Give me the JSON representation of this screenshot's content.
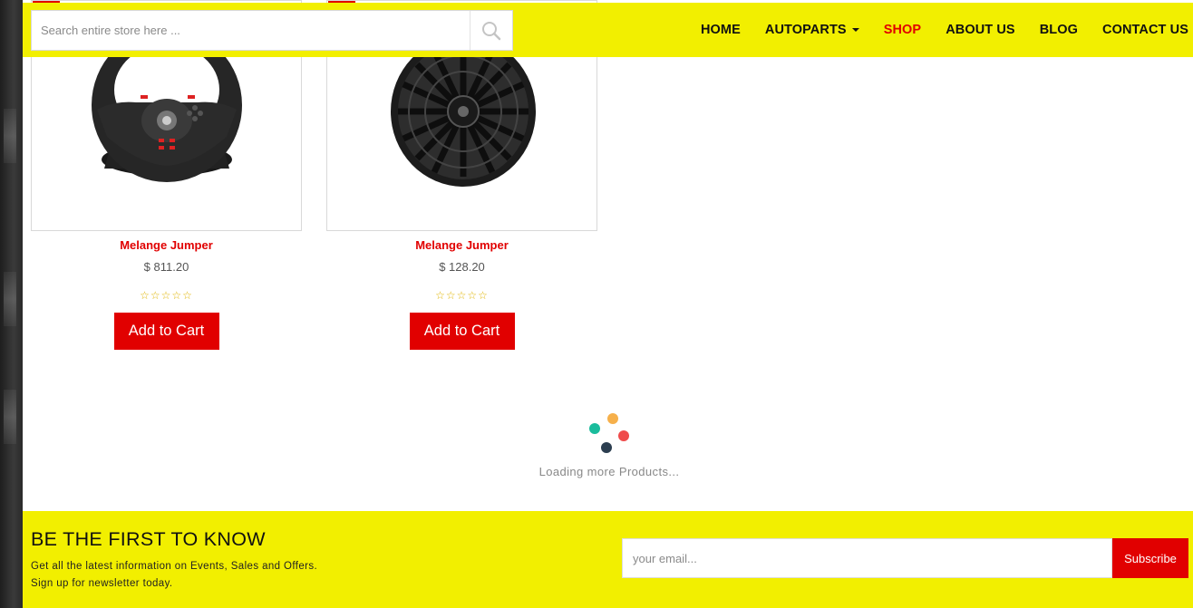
{
  "header": {
    "search_placeholder": "Search entire store here ...",
    "nav": [
      {
        "label": "HOME",
        "active": false,
        "dropdown": false
      },
      {
        "label": "AUTOPARTS",
        "active": false,
        "dropdown": true
      },
      {
        "label": "SHOP",
        "active": true,
        "dropdown": false
      },
      {
        "label": "ABOUT US",
        "active": false,
        "dropdown": false
      },
      {
        "label": "BLOG",
        "active": false,
        "dropdown": false
      },
      {
        "label": "CONTACT US",
        "active": false,
        "dropdown": false
      }
    ]
  },
  "products": [
    {
      "name": "Melange Jumper",
      "price": "$ 811.20",
      "rating": 0,
      "image": "steering-wheel",
      "cart_label": "Add to Cart"
    },
    {
      "name": "Melange Jumper",
      "price": "$ 128.20",
      "rating": 0,
      "image": "alloy-wheel",
      "cart_label": "Add to Cart"
    }
  ],
  "loader": {
    "text": "Loading more Products...",
    "dot_colors": [
      "#f6b04b",
      "#1abc9c",
      "#ef4b4b",
      "#2c3e50"
    ]
  },
  "newsletter": {
    "title": "BE THE FIRST TO KNOW",
    "line1": "Get all the latest information on Events, Sales and Offers.",
    "line2": "Sign up for newsletter today.",
    "email_placeholder": "your email...",
    "button_label": "Subscribe"
  },
  "colors": {
    "accent": "#e10000",
    "header_bg": "#f2ef00"
  }
}
